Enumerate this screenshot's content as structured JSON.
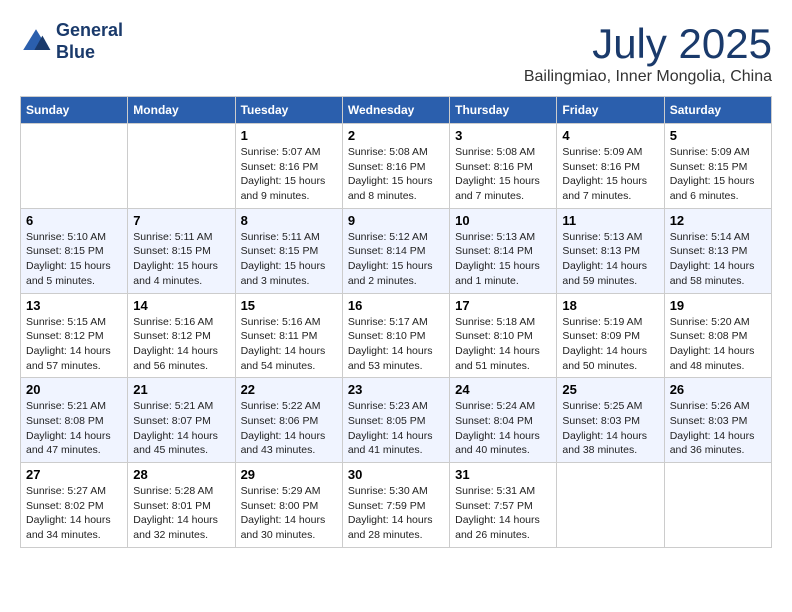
{
  "header": {
    "logo_line1": "General",
    "logo_line2": "Blue",
    "month": "July 2025",
    "location": "Bailingmiao, Inner Mongolia, China"
  },
  "weekdays": [
    "Sunday",
    "Monday",
    "Tuesday",
    "Wednesday",
    "Thursday",
    "Friday",
    "Saturday"
  ],
  "weeks": [
    [
      {
        "day": "",
        "text": ""
      },
      {
        "day": "",
        "text": ""
      },
      {
        "day": "1",
        "text": "Sunrise: 5:07 AM\nSunset: 8:16 PM\nDaylight: 15 hours\nand 9 minutes."
      },
      {
        "day": "2",
        "text": "Sunrise: 5:08 AM\nSunset: 8:16 PM\nDaylight: 15 hours\nand 8 minutes."
      },
      {
        "day": "3",
        "text": "Sunrise: 5:08 AM\nSunset: 8:16 PM\nDaylight: 15 hours\nand 7 minutes."
      },
      {
        "day": "4",
        "text": "Sunrise: 5:09 AM\nSunset: 8:16 PM\nDaylight: 15 hours\nand 7 minutes."
      },
      {
        "day": "5",
        "text": "Sunrise: 5:09 AM\nSunset: 8:15 PM\nDaylight: 15 hours\nand 6 minutes."
      }
    ],
    [
      {
        "day": "6",
        "text": "Sunrise: 5:10 AM\nSunset: 8:15 PM\nDaylight: 15 hours\nand 5 minutes."
      },
      {
        "day": "7",
        "text": "Sunrise: 5:11 AM\nSunset: 8:15 PM\nDaylight: 15 hours\nand 4 minutes."
      },
      {
        "day": "8",
        "text": "Sunrise: 5:11 AM\nSunset: 8:15 PM\nDaylight: 15 hours\nand 3 minutes."
      },
      {
        "day": "9",
        "text": "Sunrise: 5:12 AM\nSunset: 8:14 PM\nDaylight: 15 hours\nand 2 minutes."
      },
      {
        "day": "10",
        "text": "Sunrise: 5:13 AM\nSunset: 8:14 PM\nDaylight: 15 hours\nand 1 minute."
      },
      {
        "day": "11",
        "text": "Sunrise: 5:13 AM\nSunset: 8:13 PM\nDaylight: 14 hours\nand 59 minutes."
      },
      {
        "day": "12",
        "text": "Sunrise: 5:14 AM\nSunset: 8:13 PM\nDaylight: 14 hours\nand 58 minutes."
      }
    ],
    [
      {
        "day": "13",
        "text": "Sunrise: 5:15 AM\nSunset: 8:12 PM\nDaylight: 14 hours\nand 57 minutes."
      },
      {
        "day": "14",
        "text": "Sunrise: 5:16 AM\nSunset: 8:12 PM\nDaylight: 14 hours\nand 56 minutes."
      },
      {
        "day": "15",
        "text": "Sunrise: 5:16 AM\nSunset: 8:11 PM\nDaylight: 14 hours\nand 54 minutes."
      },
      {
        "day": "16",
        "text": "Sunrise: 5:17 AM\nSunset: 8:10 PM\nDaylight: 14 hours\nand 53 minutes."
      },
      {
        "day": "17",
        "text": "Sunrise: 5:18 AM\nSunset: 8:10 PM\nDaylight: 14 hours\nand 51 minutes."
      },
      {
        "day": "18",
        "text": "Sunrise: 5:19 AM\nSunset: 8:09 PM\nDaylight: 14 hours\nand 50 minutes."
      },
      {
        "day": "19",
        "text": "Sunrise: 5:20 AM\nSunset: 8:08 PM\nDaylight: 14 hours\nand 48 minutes."
      }
    ],
    [
      {
        "day": "20",
        "text": "Sunrise: 5:21 AM\nSunset: 8:08 PM\nDaylight: 14 hours\nand 47 minutes."
      },
      {
        "day": "21",
        "text": "Sunrise: 5:21 AM\nSunset: 8:07 PM\nDaylight: 14 hours\nand 45 minutes."
      },
      {
        "day": "22",
        "text": "Sunrise: 5:22 AM\nSunset: 8:06 PM\nDaylight: 14 hours\nand 43 minutes."
      },
      {
        "day": "23",
        "text": "Sunrise: 5:23 AM\nSunset: 8:05 PM\nDaylight: 14 hours\nand 41 minutes."
      },
      {
        "day": "24",
        "text": "Sunrise: 5:24 AM\nSunset: 8:04 PM\nDaylight: 14 hours\nand 40 minutes."
      },
      {
        "day": "25",
        "text": "Sunrise: 5:25 AM\nSunset: 8:03 PM\nDaylight: 14 hours\nand 38 minutes."
      },
      {
        "day": "26",
        "text": "Sunrise: 5:26 AM\nSunset: 8:03 PM\nDaylight: 14 hours\nand 36 minutes."
      }
    ],
    [
      {
        "day": "27",
        "text": "Sunrise: 5:27 AM\nSunset: 8:02 PM\nDaylight: 14 hours\nand 34 minutes."
      },
      {
        "day": "28",
        "text": "Sunrise: 5:28 AM\nSunset: 8:01 PM\nDaylight: 14 hours\nand 32 minutes."
      },
      {
        "day": "29",
        "text": "Sunrise: 5:29 AM\nSunset: 8:00 PM\nDaylight: 14 hours\nand 30 minutes."
      },
      {
        "day": "30",
        "text": "Sunrise: 5:30 AM\nSunset: 7:59 PM\nDaylight: 14 hours\nand 28 minutes."
      },
      {
        "day": "31",
        "text": "Sunrise: 5:31 AM\nSunset: 7:57 PM\nDaylight: 14 hours\nand 26 minutes."
      },
      {
        "day": "",
        "text": ""
      },
      {
        "day": "",
        "text": ""
      }
    ]
  ]
}
